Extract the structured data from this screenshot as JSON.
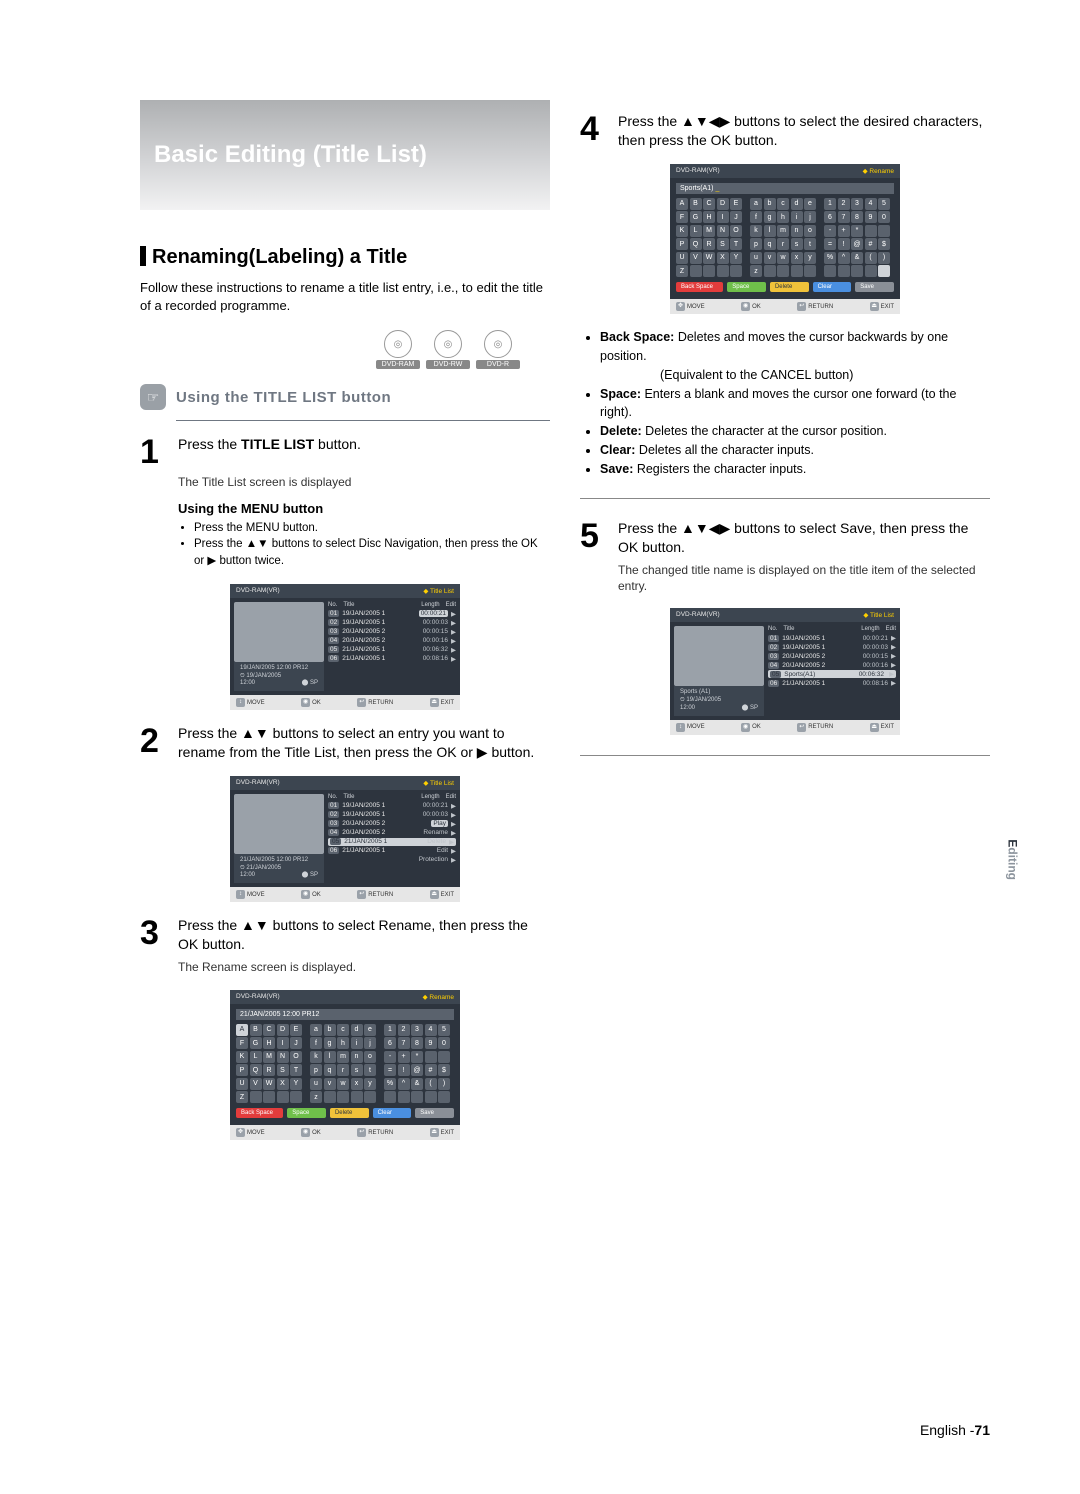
{
  "page": {
    "language": "English",
    "number": "71"
  },
  "sidetab": {
    "a": "E",
    "b": "diting"
  },
  "banner": {
    "title": "Basic Editing (Title List)"
  },
  "section": {
    "heading": "Renaming(Labeling) a Title",
    "intro": "Follow these instructions to rename a title list entry, i.e., to edit the title of a recorded programme."
  },
  "discs": [
    "DVD-RAM",
    "DVD-RW",
    "DVD-R"
  ],
  "sub": {
    "title": "Using the TITLE LIST button"
  },
  "step1": {
    "num": "1",
    "text_a": "Press the ",
    "text_b": "TITLE LIST",
    "text_c": " button.",
    "sub": "The Title List screen is displayed",
    "menu_h": "Using the MENU button",
    "menu_items": [
      "Press the MENU button.",
      "Press the ▲▼ buttons to select Disc Navigation, then press the OK or ▶ button twice."
    ]
  },
  "step2": {
    "num": "2",
    "text": "Press the ▲▼ buttons to select an entry you want to rename from the Title List, then press the OK or ▶ button."
  },
  "step3": {
    "num": "3",
    "text": "Press the ▲▼ buttons to select Rename, then press the OK button.",
    "sub": "The Rename screen is displayed."
  },
  "step4": {
    "num": "4",
    "text": "Press the ▲▼◀▶ buttons to select the desired characters, then press the OK button."
  },
  "step5": {
    "num": "5",
    "text": "Press the ▲▼◀▶ buttons to select Save, then press the OK button.",
    "sub": "The changed title name is displayed on the title item of the selected entry."
  },
  "defs": [
    {
      "k": "Back Space:",
      "v": "Deletes and moves the cursor backwards by one position.",
      "v2": "(Equivalent to the CANCEL button)"
    },
    {
      "k": "Space:",
      "v": "Enters a blank and moves the cursor one forward (to the right)."
    },
    {
      "k": "Delete:",
      "v": "Deletes the character at the cursor position."
    },
    {
      "k": "Clear:",
      "v": "Deletes all the character inputs."
    },
    {
      "k": "Save:",
      "v": "Registers the character inputs."
    }
  ],
  "osd_common": {
    "hdr_left": "DVD-RAM(VR)",
    "foot": [
      "MOVE",
      "OK",
      "RETURN",
      "EXIT"
    ]
  },
  "osd1": {
    "hdr_right": "Title List",
    "list_head": [
      "No.",
      "Title",
      "Length",
      "Edit"
    ],
    "rows": [
      {
        "n": "01",
        "t": "19/JAN/2005 1",
        "l": "00:00:21",
        "hl": true
      },
      {
        "n": "02",
        "t": "19/JAN/2005 1",
        "l": "00:00:03"
      },
      {
        "n": "03",
        "t": "20/JAN/2005 2",
        "l": "00:00:15"
      },
      {
        "n": "04",
        "t": "20/JAN/2005 2",
        "l": "00:00:16"
      },
      {
        "n": "05",
        "t": "21/JAN/2005 1",
        "l": "00:06:32"
      },
      {
        "n": "06",
        "t": "21/JAN/2005 1",
        "l": "00:08:16"
      }
    ],
    "meta": [
      "19/JAN/2005 12:00 PR12",
      "19/JAN/2005",
      "12:00",
      "SP"
    ]
  },
  "osd2": {
    "hdr_right": "Title List",
    "list_head": [
      "No.",
      "Title",
      "Length",
      "Edit"
    ],
    "rows": [
      {
        "n": "01",
        "t": "19/JAN/2005 1",
        "l": "00:00:21"
      },
      {
        "n": "02",
        "t": "19/JAN/2005 1",
        "l": "00:00:03"
      },
      {
        "n": "03",
        "t": "20/JAN/2005 2",
        "l": "Play",
        "hl": true
      },
      {
        "n": "04",
        "t": "20/JAN/2005 2",
        "l": "Rename"
      },
      {
        "n": "05",
        "t": "21/JAN/2005 1",
        "l": "Delete",
        "sel": true
      },
      {
        "n": "06",
        "t": "21/JAN/2005 1",
        "l": "Edit"
      },
      {
        "n": "",
        "t": "",
        "l": "Protection"
      }
    ],
    "meta": [
      "21/JAN/2005 12:00 PR12",
      "21/JAN/2005",
      "12:00",
      "SP"
    ]
  },
  "osd3": {
    "hdr_right": "Rename",
    "input": "21/JAN/2005 12:00 PR12"
  },
  "osd4": {
    "hdr_right": "Rename",
    "input": "Sports(A1)"
  },
  "osd5": {
    "hdr_right": "Title List",
    "list_head": [
      "No.",
      "Title",
      "Length",
      "Edit"
    ],
    "rows": [
      {
        "n": "01",
        "t": "19/JAN/2005 1",
        "l": "00:00:21"
      },
      {
        "n": "02",
        "t": "19/JAN/2005 1",
        "l": "00:00:03"
      },
      {
        "n": "03",
        "t": "20/JAN/2005 2",
        "l": "00:00:15"
      },
      {
        "n": "04",
        "t": "20/JAN/2005 2",
        "l": "00:00:16"
      },
      {
        "n": "05",
        "t": "Sports(A1)",
        "l": "00:06:32",
        "sel": true,
        "hl": true
      },
      {
        "n": "06",
        "t": "21/JAN/2005 1",
        "l": "00:08:16"
      }
    ],
    "meta": [
      "Sports (A1)",
      "19/JAN/2005",
      "12:00",
      "SP"
    ]
  },
  "kbd": {
    "upper": [
      "A",
      "B",
      "C",
      "D",
      "E",
      "F",
      "G",
      "H",
      "I",
      "J",
      "K",
      "L",
      "M",
      "N",
      "O",
      "P",
      "Q",
      "R",
      "S",
      "T",
      "U",
      "V",
      "W",
      "X",
      "Y",
      "Z",
      "",
      "",
      "",
      ""
    ],
    "lower": [
      "a",
      "b",
      "c",
      "d",
      "e",
      "f",
      "g",
      "h",
      "i",
      "j",
      "k",
      "l",
      "m",
      "n",
      "o",
      "p",
      "q",
      "r",
      "s",
      "t",
      "u",
      "v",
      "w",
      "x",
      "y",
      "z",
      "",
      "",
      "",
      ""
    ],
    "sym": [
      "1",
      "2",
      "3",
      "4",
      "5",
      "6",
      "7",
      "8",
      "9",
      "0",
      "-",
      "+",
      "*",
      "",
      "",
      "=",
      "!",
      "@",
      "#",
      "$",
      "%",
      "^",
      "&",
      "(",
      ")",
      "",
      "",
      "",
      "",
      ""
    ],
    "buttons": {
      "bs": "Back Space",
      "sp": "Space",
      "de": "Delete",
      "cl": "Clear",
      "sv": "Save"
    }
  }
}
